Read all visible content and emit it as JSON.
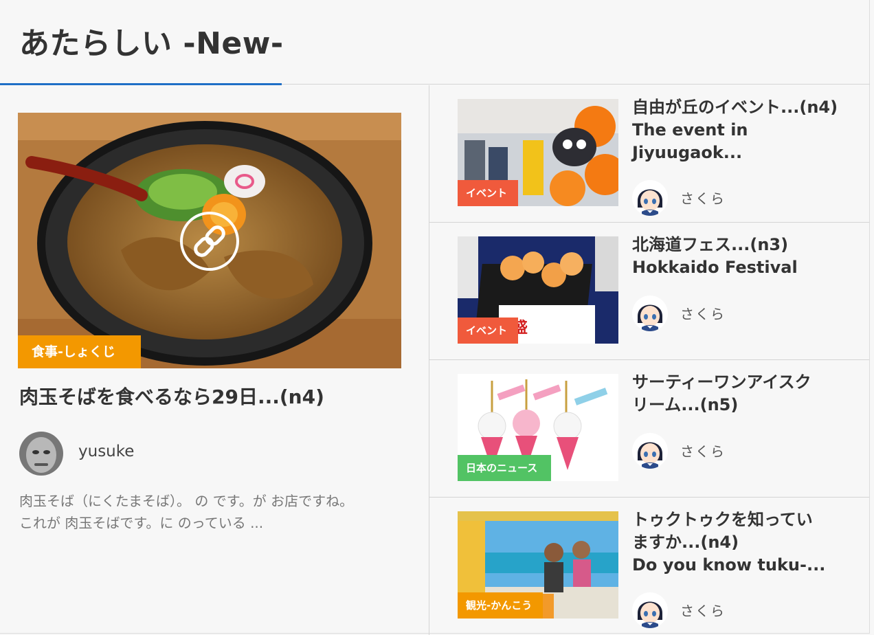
{
  "section": {
    "title": "あたらしい -New-"
  },
  "featured": {
    "category": "食事-しょくじ",
    "category_color": "#f39800",
    "title": "肉玉そばを食べるなら29日...(n4)",
    "author": "yusuke",
    "excerpt": "肉玉そば（にくたまそば）。 の です。が お店ですね。　　　　 これが 肉玉そばです。に のっている ..."
  },
  "posts": [
    {
      "category": "イベント",
      "category_color": "#f05a3c",
      "title_lines": [
        "自由が丘のイベント...(n4)",
        "The event in",
        "Jiyuugaok..."
      ],
      "author": "さくら"
    },
    {
      "category": "イベント",
      "category_color": "#f05a3c",
      "title_lines": [
        "北海道フェス...(n3)",
        "Hokkaido Festival"
      ],
      "author": "さくら"
    },
    {
      "category": "日本のニュース",
      "category_color": "#52c364",
      "title_lines": [
        "サーティーワンアイスク",
        "リーム...(n5)"
      ],
      "author": "さくら"
    },
    {
      "category": "観光-かんこう",
      "category_color": "#f39800",
      "title_lines": [
        "トゥクトゥクを知ってい",
        "ますか...(n4)",
        "Do you know tuku-..."
      ],
      "author": "さくら"
    }
  ]
}
